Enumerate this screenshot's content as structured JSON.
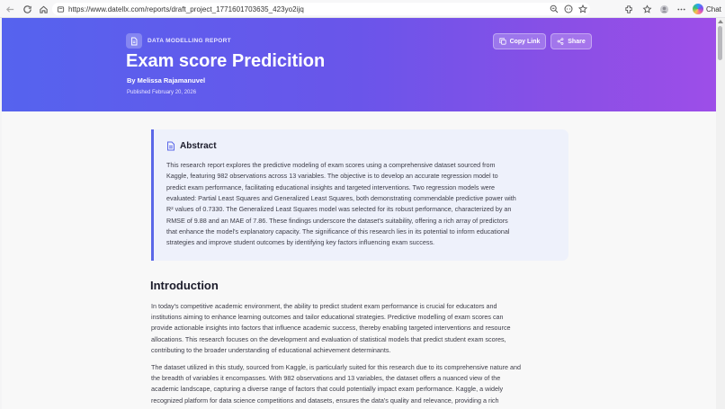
{
  "browser": {
    "url": "https://www.datellx.com/reports/draft_project_1771601703635_423yo2ijq",
    "chat_label": "Chat"
  },
  "hero": {
    "tag": "DATA MODELLING REPORT",
    "title": "Exam score Predicition",
    "author": "By Melissa Rajamanuvel",
    "published": "Published February 20, 2026",
    "copy_link_label": "Copy Link",
    "share_label": "Share"
  },
  "abstract": {
    "heading": "Abstract",
    "lines": [
      "This research report explores the predictive modeling of exam scores using a comprehensive dataset sourced from",
      "Kaggle, featuring 982 observations across 13 variables. The objective is to develop an accurate regression model to",
      "predict exam performance, facilitating educational insights and targeted interventions. Two regression models were",
      "evaluated: Partial Least Squares and Generalized Least Squares, both demonstrating commendable predictive power with",
      "R² values of 0.7330. The Generalized Least Squares model was selected for its robust performance, characterized by an",
      "RMSE of 9.88 and an MAE of 7.86. These findings underscore the dataset's suitability, offering a rich array of predictors",
      "that enhance the model's explanatory capacity. The significance of this research lies in its potential to inform educational",
      "strategies and improve student outcomes by identifying key factors influencing exam success."
    ]
  },
  "introduction": {
    "heading": "Introduction",
    "p1_lines": [
      "In today's competitive academic environment, the ability to predict student exam performance is crucial for educators and",
      "institutions aiming to enhance learning outcomes and tailor educational strategies. Predictive modelling of exam scores can",
      "provide actionable insights into factors that influence academic success, thereby enabling targeted interventions and resource",
      "allocations. This research focuses on the development and evaluation of statistical models that predict student exam scores,",
      "contributing to the broader understanding of educational achievement determinants."
    ],
    "p2_lines": [
      "The dataset utilized in this study, sourced from Kaggle, is particularly suited for this research due to its comprehensive nature and",
      "the breadth of variables it encompasses. With 982 observations and 13 variables, the dataset offers a nuanced view of the",
      "academic landscape, capturing a diverse range of factors that could potentially impact exam performance. Kaggle, a widely",
      "recognized platform for data science competitions and datasets, ensures the data's quality and relevance, providing a rich"
    ]
  }
}
